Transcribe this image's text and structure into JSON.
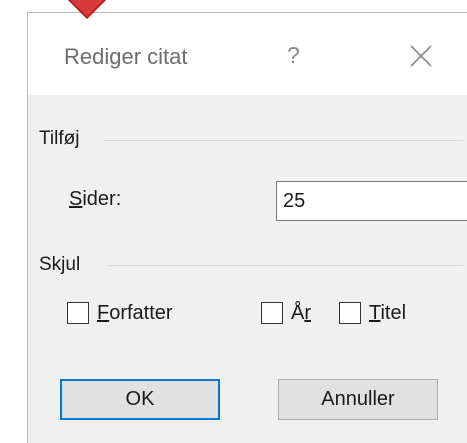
{
  "dialog": {
    "title": "Rediger citat",
    "help_glyph": "?",
    "close_icon": "close-icon"
  },
  "add_group": {
    "label": "Tilføj",
    "pages": {
      "label_mnemonic": "S",
      "label_rest": "ider:",
      "value": "25"
    }
  },
  "hide_group": {
    "label": "Skjul",
    "options": [
      {
        "mnemonic": "F",
        "rest": "orfatter",
        "checked": false
      },
      {
        "prefix": "Å",
        "mnemonic": "r",
        "checked": false
      },
      {
        "mnemonic": "T",
        "rest": "itel",
        "checked": false
      }
    ]
  },
  "buttons": {
    "ok": "OK",
    "cancel": "Annuller"
  },
  "colors": {
    "accent": "#0078d7",
    "marker": "#d93a3a",
    "dialog_bg": "#f0f0f0"
  }
}
